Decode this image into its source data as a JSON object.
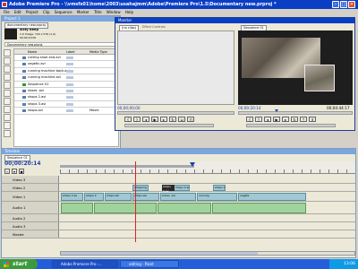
{
  "app": {
    "title": "Adobe Premiere Pro - \\\\vmsfs01\\home\\2003\\usahajmm\\Adobe\\Premiere Pro\\1.5\\Documentary new.prproj *"
  },
  "menu": [
    "File",
    "Edit",
    "Project",
    "Clip",
    "Sequence",
    "Marker",
    "Title",
    "Window",
    "Help"
  ],
  "project": {
    "title": "Project 1",
    "tab": "documentary new.prproj",
    "preview_name": "sixty beep",
    "preview_info": "1.0 Image, 720 x 576 (1.0)",
    "preview_duration": "00;00;10;00",
    "bin_label": "Documentary new.prproj",
    "col_name": "Name",
    "col_label": "Label",
    "col_media": "Media Type",
    "items": [
      {
        "name": "cutting shoe end.avi",
        "media": ""
      },
      {
        "name": "vegetic.avi",
        "media": ""
      },
      {
        "name": "running machine back.avi",
        "media": ""
      },
      {
        "name": "running machine.avi",
        "media": ""
      },
      {
        "name": "Sequence 01",
        "media": ""
      },
      {
        "name": "shoes .avi",
        "media": ""
      },
      {
        "name": "shops 2.avi",
        "media": ""
      },
      {
        "name": "shops 3.avi",
        "media": ""
      },
      {
        "name": "shops.avi",
        "media": "Movie"
      }
    ]
  },
  "monitor": {
    "title": "Monitor",
    "tab_source": "(no clips)",
    "tab_effect": "Effect Controls",
    "tab_program": "Sequence 01",
    "source_timecode": "00;00;00;00",
    "program_timecode": "00;00:20:14",
    "program_duration": "00;04:44:17"
  },
  "timeline": {
    "title": "Timeline",
    "tab": "Sequence 01",
    "timecode": "00;00:20:14",
    "tracks": [
      {
        "name": "Video 3",
        "type": "video"
      },
      {
        "name": "Video 2",
        "type": "video"
      },
      {
        "name": "Video 1",
        "type": "video"
      },
      {
        "name": "Audio 1",
        "type": "audio"
      },
      {
        "name": "Audio 2",
        "type": "audio"
      },
      {
        "name": "Audio 3",
        "type": "audio"
      },
      {
        "name": "Master",
        "type": "audio"
      }
    ],
    "clips_v2": [
      "shopping 2",
      "shops 2.av",
      "shops 2.av"
    ],
    "clips_v1": [
      "shops 2.av",
      "shops 2",
      "shops.avi",
      "shops.avi",
      "shoes .avi",
      "running",
      "vegeta"
    ],
    "clip_selected": "shops 2.av"
  },
  "taskbar": {
    "start": "start",
    "buttons": [
      "Adobe Premiere Pro -...",
      "editing - Paint"
    ],
    "clock": "13:06"
  },
  "colors": {
    "titlebar": "#0a3ec4",
    "taskbar": "#245edb",
    "start": "#3c9a3c",
    "playhead": "#e02020",
    "video_clip": "#9ec9d5",
    "audio_clip": "#9fd39b"
  }
}
